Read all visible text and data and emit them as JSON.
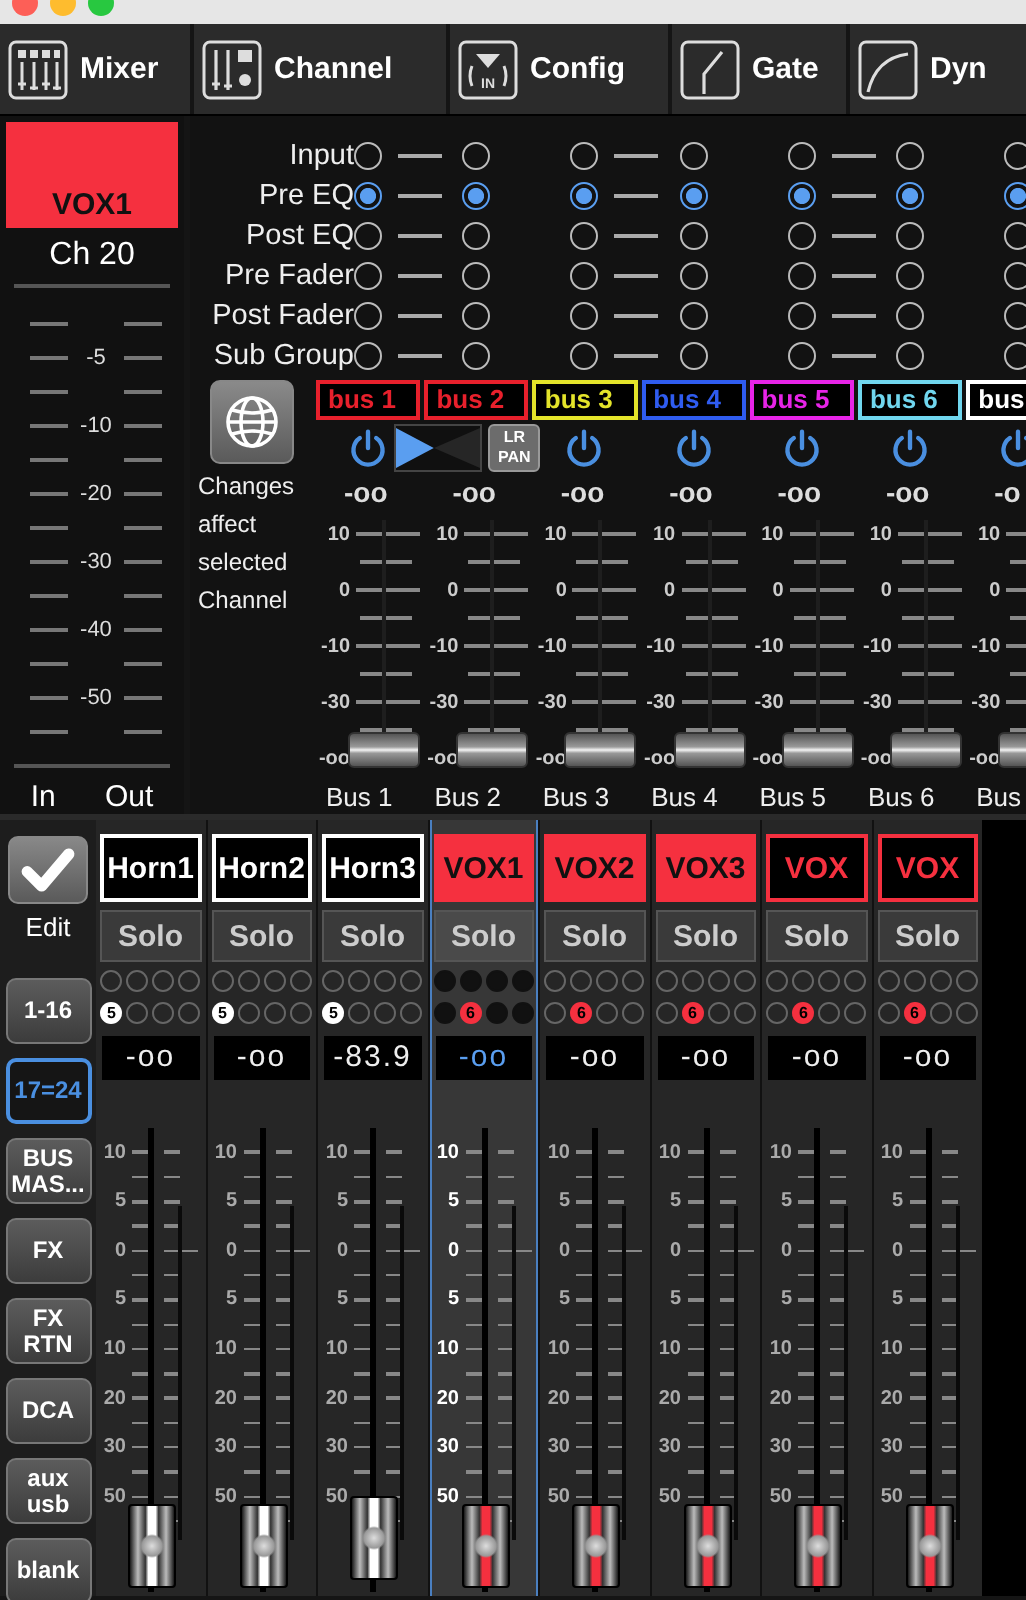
{
  "tabs": [
    {
      "label": "Mixer"
    },
    {
      "label": "Channel"
    },
    {
      "label": "Config",
      "icon_text": "IN"
    },
    {
      "label": "Gate"
    },
    {
      "label": "Dyn"
    }
  ],
  "selected_channel": {
    "name": "VOX1",
    "color": "#f5303f",
    "number": "Ch 20",
    "scale": [
      "-5",
      "-10",
      "-20",
      "-30",
      "-40",
      "-50"
    ],
    "meters": [
      "In",
      "Out"
    ]
  },
  "routing": {
    "taps": [
      "Input",
      "Pre EQ",
      "Post EQ",
      "Pre Fader",
      "Post Fader",
      "Sub Group"
    ],
    "note": "Changes affect selected Channel"
  },
  "buses": [
    {
      "name": "bus 1",
      "color": "#e8202c",
      "tap_selected": [
        false,
        true,
        false,
        false,
        false,
        false
      ],
      "kind": "power",
      "level_text": "-oo",
      "scale": [
        "10",
        "0",
        "-10",
        "-30",
        "-oo"
      ],
      "level": 0,
      "label": "Bus 1"
    },
    {
      "name": "bus 2",
      "color": "#e8202c",
      "tap_selected": [
        false,
        true,
        false,
        false,
        false,
        false
      ],
      "kind": "pan",
      "pan": {
        "level": 0.45
      },
      "pan_button": "LR PAN",
      "level_text": "-oo",
      "scale": [
        "10",
        "0",
        "-10",
        "-30",
        "-oo"
      ],
      "level": 0,
      "label": "Bus 2"
    },
    {
      "name": "bus 3",
      "color": "#e4e42a",
      "tap_selected": [
        false,
        true,
        false,
        false,
        false,
        false
      ],
      "kind": "power",
      "level_text": "-oo",
      "scale": [
        "10",
        "0",
        "-10",
        "-30",
        "-oo"
      ],
      "level": 0,
      "label": "Bus 3"
    },
    {
      "name": "bus 4",
      "color": "#2f5cf0",
      "tap_selected": [
        false,
        true,
        false,
        false,
        false,
        false
      ],
      "kind": "power",
      "level_text": "-oo",
      "scale": [
        "10",
        "0",
        "-10",
        "-30",
        "-oo"
      ],
      "level": 0,
      "label": "Bus 4"
    },
    {
      "name": "bus 5",
      "color": "#e824e8",
      "tap_selected": [
        false,
        true,
        false,
        false,
        false,
        false
      ],
      "kind": "power",
      "level_text": "-oo",
      "scale": [
        "10",
        "0",
        "-10",
        "-30",
        "-oo"
      ],
      "level": 0,
      "label": "Bus 5"
    },
    {
      "name": "bus 6",
      "color": "#70d6ee",
      "tap_selected": [
        false,
        true,
        false,
        false,
        false,
        false
      ],
      "kind": "power",
      "level_text": "-oo",
      "scale": [
        "10",
        "0",
        "-10",
        "-30",
        "-oo"
      ],
      "level": 0,
      "label": "Bus 6"
    },
    {
      "name": "bus",
      "color": "#ffffff",
      "tap_selected": [
        false,
        true,
        false,
        false,
        false,
        false
      ],
      "kind": "power",
      "level_text": "-o",
      "scale": [
        "10",
        "0",
        "-10",
        "-30",
        "-oo"
      ],
      "level": 0,
      "label": "Bus"
    }
  ],
  "sidebar": {
    "edit_label": "Edit",
    "buttons": [
      {
        "label": "1-16",
        "selected": false
      },
      {
        "label": "17=24",
        "selected": true
      },
      {
        "label": "BUS MAS...",
        "selected": false
      },
      {
        "label": "FX",
        "selected": false
      },
      {
        "label": "FX RTN",
        "selected": false
      },
      {
        "label": "DCA",
        "selected": false
      },
      {
        "label": "aux usb",
        "selected": false
      },
      {
        "label": "blank",
        "selected": false
      }
    ]
  },
  "strips": [
    {
      "name": "Horn1",
      "color": "#ffffff",
      "filled": false,
      "solo": "Solo",
      "dots": [
        {
          "kind": "empty"
        },
        {
          "kind": "empty"
        },
        {
          "kind": "empty"
        },
        {
          "kind": "empty"
        },
        {
          "kind": "group",
          "label": "5"
        },
        {
          "kind": "empty"
        },
        {
          "kind": "empty"
        },
        {
          "kind": "empty"
        }
      ],
      "value": "-oo",
      "scale": [
        "10",
        "5",
        "0",
        "5",
        "10",
        "20",
        "30",
        "50"
      ],
      "level": 0,
      "selected": false
    },
    {
      "name": "Horn2",
      "color": "#ffffff",
      "filled": false,
      "solo": "Solo",
      "dots": [
        {
          "kind": "empty"
        },
        {
          "kind": "empty"
        },
        {
          "kind": "empty"
        },
        {
          "kind": "empty"
        },
        {
          "kind": "group",
          "label": "5"
        },
        {
          "kind": "empty"
        },
        {
          "kind": "empty"
        },
        {
          "kind": "empty"
        }
      ],
      "value": "-oo",
      "scale": [
        "10",
        "5",
        "0",
        "5",
        "10",
        "20",
        "30",
        "50"
      ],
      "level": 0,
      "selected": false
    },
    {
      "name": "Horn3",
      "color": "#ffffff",
      "filled": false,
      "solo": "Solo",
      "dots": [
        {
          "kind": "empty"
        },
        {
          "kind": "empty"
        },
        {
          "kind": "empty"
        },
        {
          "kind": "empty"
        },
        {
          "kind": "group",
          "label": "5"
        },
        {
          "kind": "empty"
        },
        {
          "kind": "empty"
        },
        {
          "kind": "empty"
        }
      ],
      "value": "-83.9",
      "scale": [
        "10",
        "5",
        "0",
        "5",
        "10",
        "20",
        "30",
        "50"
      ],
      "level": 0.02,
      "selected": false
    },
    {
      "name": "VOX1",
      "color": "#f5303f",
      "filled": true,
      "solo": "Solo",
      "dots": [
        {
          "kind": "empty"
        },
        {
          "kind": "empty"
        },
        {
          "kind": "empty"
        },
        {
          "kind": "empty"
        },
        {
          "kind": "empty"
        },
        {
          "kind": "group",
          "label": "6"
        },
        {
          "kind": "empty"
        },
        {
          "kind": "empty"
        }
      ],
      "value": "-oo",
      "scale": [
        "10",
        "5",
        "0",
        "5",
        "10",
        "20",
        "30",
        "50"
      ],
      "level": 0,
      "selected": true
    },
    {
      "name": "VOX2",
      "color": "#f5303f",
      "filled": true,
      "solo": "Solo",
      "dots": [
        {
          "kind": "empty"
        },
        {
          "kind": "empty"
        },
        {
          "kind": "empty"
        },
        {
          "kind": "empty"
        },
        {
          "kind": "empty"
        },
        {
          "kind": "group",
          "label": "6"
        },
        {
          "kind": "empty"
        },
        {
          "kind": "empty"
        }
      ],
      "value": "-oo",
      "scale": [
        "10",
        "5",
        "0",
        "5",
        "10",
        "20",
        "30",
        "50"
      ],
      "level": 0,
      "selected": false
    },
    {
      "name": "VOX3",
      "color": "#f5303f",
      "filled": true,
      "solo": "Solo",
      "dots": [
        {
          "kind": "empty"
        },
        {
          "kind": "empty"
        },
        {
          "kind": "empty"
        },
        {
          "kind": "empty"
        },
        {
          "kind": "empty"
        },
        {
          "kind": "group",
          "label": "6"
        },
        {
          "kind": "empty"
        },
        {
          "kind": "empty"
        }
      ],
      "value": "-oo",
      "scale": [
        "10",
        "5",
        "0",
        "5",
        "10",
        "20",
        "30",
        "50"
      ],
      "level": 0,
      "selected": false
    },
    {
      "name": "VOX",
      "color": "#f5303f",
      "filled": false,
      "solo": "Solo",
      "dots": [
        {
          "kind": "empty"
        },
        {
          "kind": "empty"
        },
        {
          "kind": "empty"
        },
        {
          "kind": "empty"
        },
        {
          "kind": "empty"
        },
        {
          "kind": "group",
          "label": "6"
        },
        {
          "kind": "empty"
        },
        {
          "kind": "empty"
        }
      ],
      "value": "-oo",
      "scale": [
        "10",
        "5",
        "0",
        "5",
        "10",
        "20",
        "30",
        "50"
      ],
      "level": 0,
      "selected": false
    },
    {
      "name": "VOX",
      "color": "#f5303f",
      "filled": false,
      "solo": "Solo",
      "dots": [
        {
          "kind": "empty"
        },
        {
          "kind": "empty"
        },
        {
          "kind": "empty"
        },
        {
          "kind": "empty"
        },
        {
          "kind": "empty"
        },
        {
          "kind": "group",
          "label": "6"
        },
        {
          "kind": "empty"
        },
        {
          "kind": "empty"
        }
      ],
      "value": "-oo",
      "scale": [
        "10",
        "5",
        "0",
        "5",
        "10",
        "20",
        "30",
        "50"
      ],
      "level": 0,
      "selected": false
    }
  ]
}
